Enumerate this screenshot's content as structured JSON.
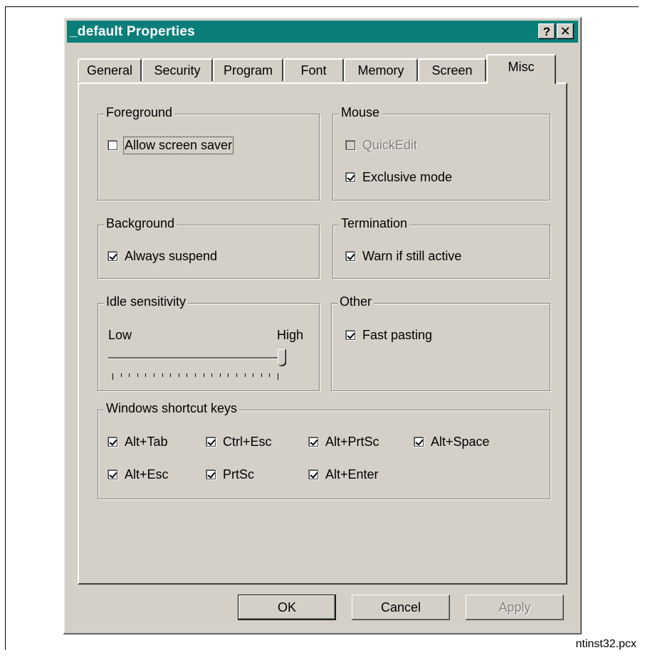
{
  "dialog": {
    "title": "_default Properties",
    "help_glyph": "?",
    "close_glyph": "✕"
  },
  "tabs": [
    "General",
    "Security",
    "Program",
    "Font",
    "Memory",
    "Screen",
    "Misc"
  ],
  "active_tab": "Misc",
  "foreground": {
    "legend": "Foreground",
    "allow_screen_saver": {
      "label": "Allow screen saver",
      "checked": false
    }
  },
  "mouse": {
    "legend": "Mouse",
    "quickedit": {
      "label": "QuickEdit",
      "checked": false,
      "disabled": true
    },
    "exclusive_mode": {
      "label": "Exclusive mode",
      "checked": true
    }
  },
  "background": {
    "legend": "Background",
    "always_suspend": {
      "label": "Always suspend",
      "checked": true
    }
  },
  "termination": {
    "legend": "Termination",
    "warn_if_still_active": {
      "label": "Warn if still active",
      "checked": true
    }
  },
  "idle": {
    "legend": "Idle sensitivity",
    "low_label": "Low",
    "high_label": "High",
    "slider_level": 1.0
  },
  "other": {
    "legend": "Other",
    "fast_pasting": {
      "label": "Fast pasting",
      "checked": true
    }
  },
  "shortcuts": {
    "legend": "Windows shortcut keys",
    "keys": [
      {
        "label": "Alt+Tab",
        "checked": true
      },
      {
        "label": "Ctrl+Esc",
        "checked": true
      },
      {
        "label": "Alt+PrtSc",
        "checked": true
      },
      {
        "label": "Alt+Space",
        "checked": true
      },
      {
        "label": "Alt+Esc",
        "checked": true
      },
      {
        "label": "PrtSc",
        "checked": true
      },
      {
        "label": "Alt+Enter",
        "checked": true
      }
    ]
  },
  "buttons": {
    "ok": "OK",
    "cancel": "Cancel",
    "apply": "Apply"
  },
  "footer_note": "ntinst32.pcx"
}
